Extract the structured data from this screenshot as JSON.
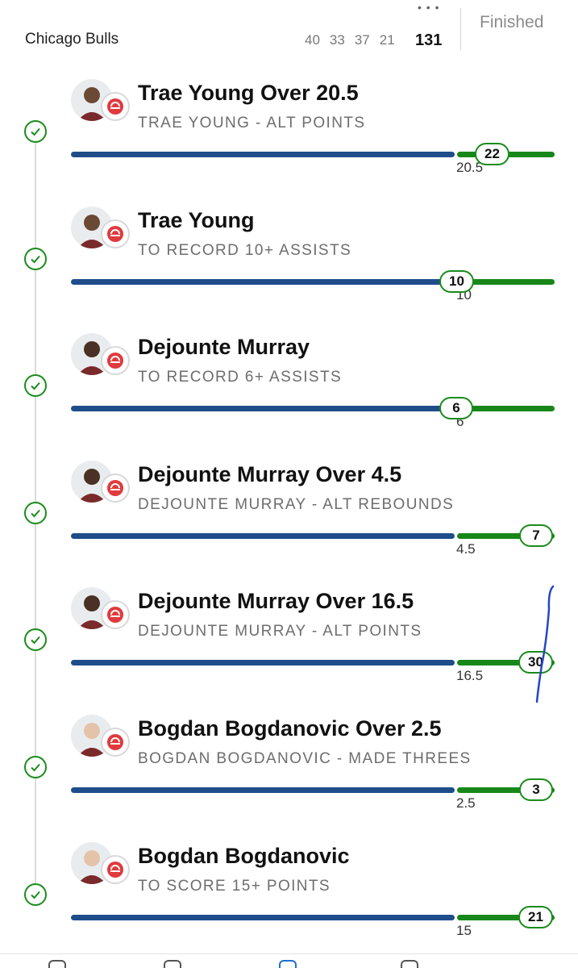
{
  "header": {
    "team": "Chicago Bulls",
    "quarters": [
      "40",
      "33",
      "37",
      "21"
    ],
    "total": "131",
    "status": "Finished",
    "dots": "• • •"
  },
  "colors": {
    "blue_bar": "#1e4d8a",
    "green_bar": "#17871a",
    "check": "#1a8c1a"
  },
  "legs": [
    {
      "title": "Trae Young Over 20.5",
      "subtitle": "TRAE YOUNG - ALT POINTS",
      "line": "20.5",
      "result": "22"
    },
    {
      "title": "Trae Young",
      "subtitle": "TO RECORD 10+ ASSISTS",
      "line": "10",
      "result": "10"
    },
    {
      "title": "Dejounte Murray",
      "subtitle": "TO RECORD 6+ ASSISTS",
      "line": "6",
      "result": "6"
    },
    {
      "title": "Dejounte Murray Over 4.5",
      "subtitle": "DEJOUNTE MURRAY - ALT REBOUNDS",
      "line": "4.5",
      "result": "7"
    },
    {
      "title": "Dejounte Murray Over 16.5",
      "subtitle": "DEJOUNTE MURRAY - ALT POINTS",
      "line": "16.5",
      "result": "30"
    },
    {
      "title": "Bogdan Bogdanovic Over 2.5",
      "subtitle": "BOGDAN BOGDANOVIC - MADE THREES",
      "line": "2.5",
      "result": "3"
    },
    {
      "title": "Bogdan Bogdanovic",
      "subtitle": "TO SCORE 15+ POINTS",
      "line": "15",
      "result": "21"
    }
  ]
}
